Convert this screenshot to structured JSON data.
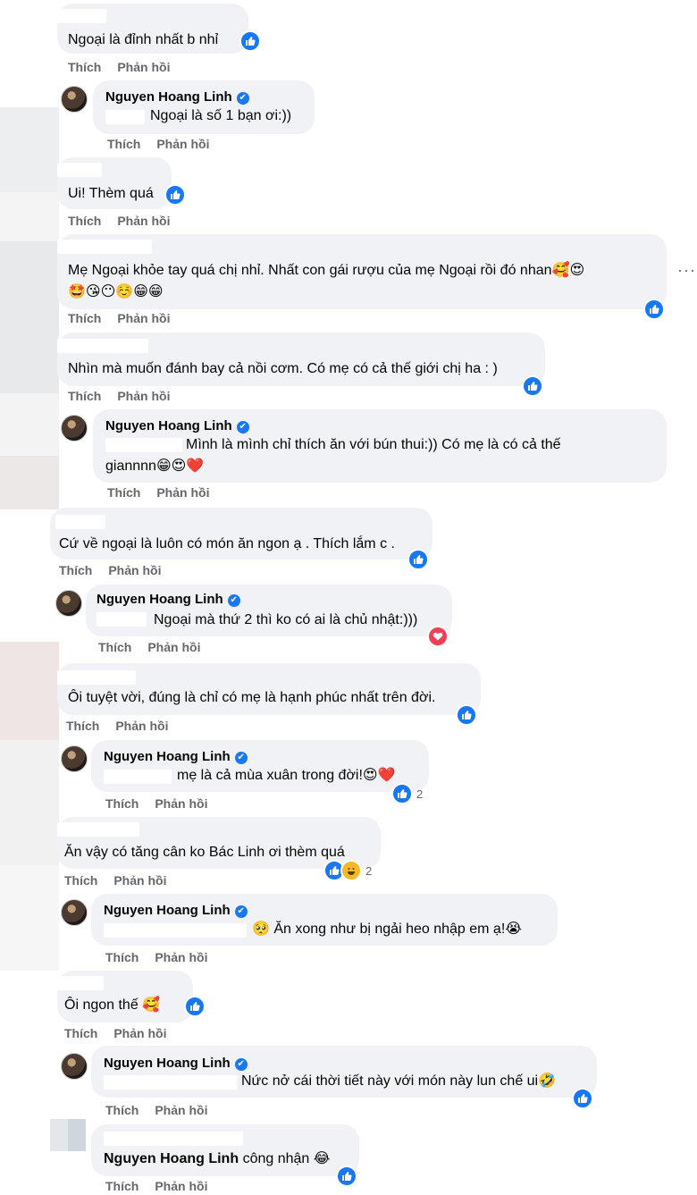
{
  "actions": {
    "like": "Thích",
    "reply": "Phản hồi"
  },
  "verified_glyph": "✔",
  "more_glyph": "···",
  "comments": [
    {
      "text": "Ngoại là đỉnh nhất b nhỉ",
      "reaction": "like"
    },
    {
      "author": "Nguyen Hoang Linh",
      "text": "Ngoại là số 1 bạn ơi:))"
    },
    {
      "text": "Ui! Thèm quá",
      "reaction": "like"
    },
    {
      "line1": "Mẹ Ngoại khỏe tay quá chị nhỉ. Nhất con gái rượu của mẹ Ngoại rồi đó nhan🥰😍",
      "line2": "🤩😘😶☺️😁😁",
      "reaction": "like"
    },
    {
      "text": "Nhìn mà muốn đánh bay cả nồi cơm. Có mẹ có cả thế giới chị ha : )",
      "reaction": "like"
    },
    {
      "author": "Nguyen Hoang Linh",
      "line1": "Mình là mình chỉ thích ăn với bún thui:)) Có mẹ là có cả thế",
      "line2": "giannnn😁😍❤️"
    },
    {
      "text": "Cứ về ngoại là luôn có món ăn ngon ạ . Thích lắm c .",
      "reaction": "like"
    },
    {
      "author": "Nguyen Hoang Linh",
      "text": "Ngoại mà thứ 2 thì ko có ai là chủ nhật:)))",
      "reaction": "heart"
    },
    {
      "text": "Ôi tuyệt vời, đúng là chỉ có mẹ là hạnh phúc nhất trên đời.",
      "reaction": "like"
    },
    {
      "author": "Nguyen Hoang Linh",
      "text": "mẹ là cả mùa xuân trong đời!😍❤️",
      "reaction": "like",
      "count": "2"
    },
    {
      "text": "Ăn vậy có tăng cân ko Bác Linh ơi thèm quá",
      "reaction": "like+haha",
      "count": "2"
    },
    {
      "author": "Nguyen Hoang Linh",
      "text": "🥺 Ăn xong như bị ngải heo nhập em ạ!😭"
    },
    {
      "text": "Ôi ngon thế 🥰",
      "reaction": "like"
    },
    {
      "author": "Nguyen Hoang Linh",
      "text": "Nức nở cái thời tiết này với món này lun chế ui🤣",
      "reaction": "like"
    },
    {
      "author": "Nguyen Hoang Linh",
      "text": "công nhận 😂",
      "reaction": "like"
    }
  ],
  "colors": {
    "bubble": "#f0f2f5",
    "like": "#1877f2",
    "heart": "#f33e58",
    "haha": "#f7b928",
    "meta": "#65676b"
  }
}
